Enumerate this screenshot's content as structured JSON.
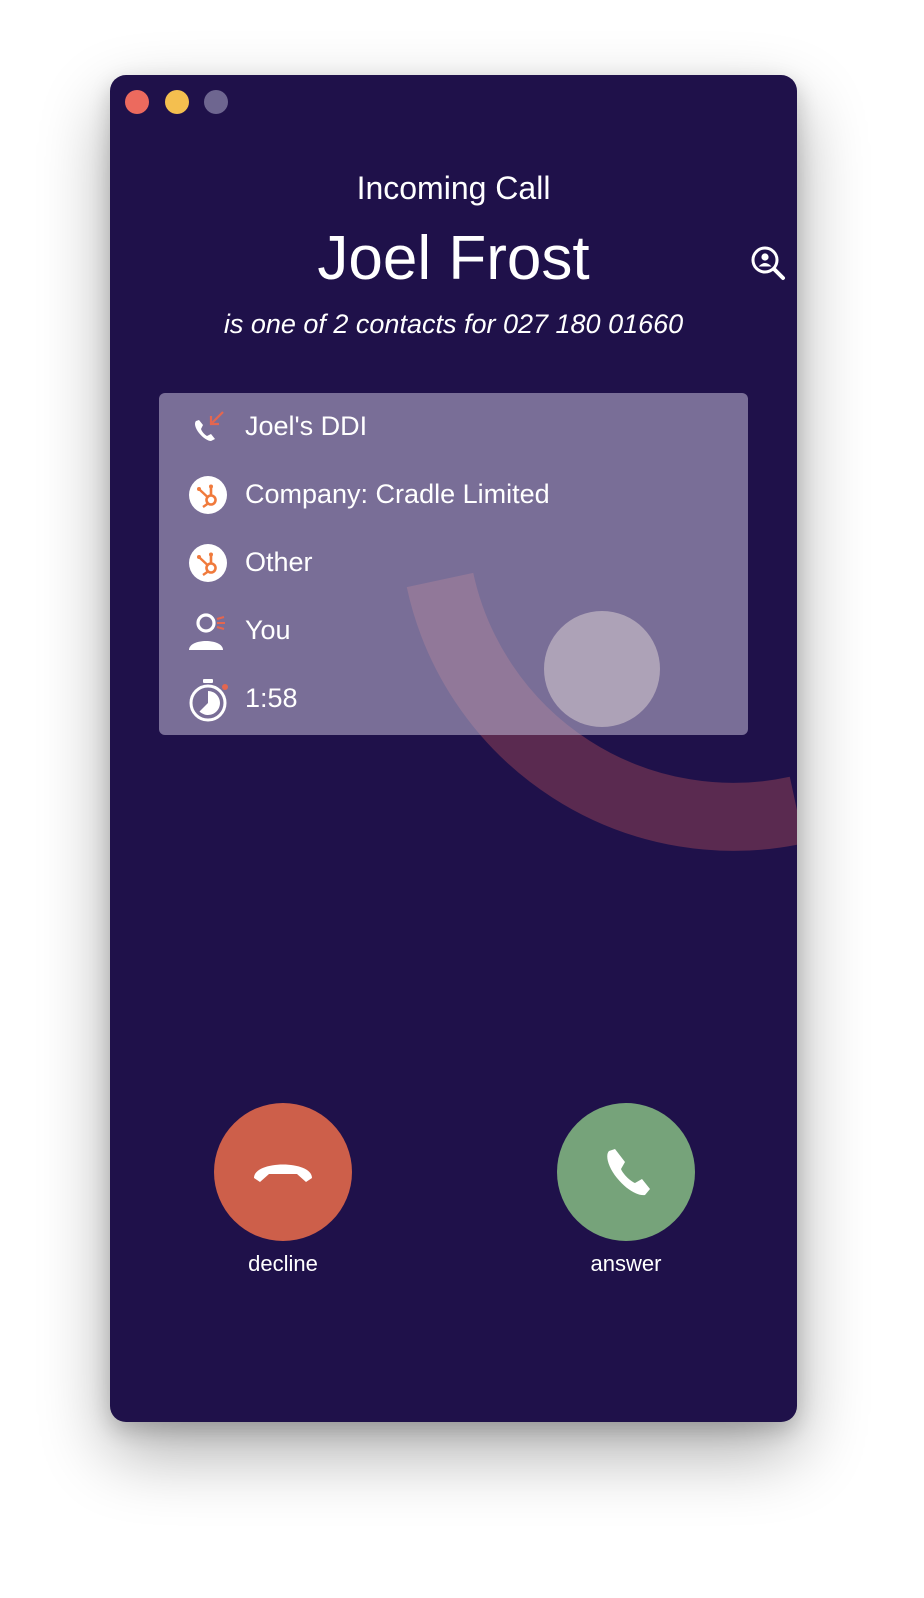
{
  "window": {
    "controls": [
      "close",
      "minimize",
      "zoom"
    ]
  },
  "call": {
    "header": "Incoming Call",
    "contact_name": "Joel Frost",
    "subtitle": "is one of 2 contacts for 027 180 01660"
  },
  "details": [
    {
      "icon": "incoming-call-icon",
      "text": "Joel's DDI"
    },
    {
      "icon": "hubspot-icon",
      "text": "Company: Cradle Limited"
    },
    {
      "icon": "hubspot-icon",
      "text": "Other"
    },
    {
      "icon": "user-owner-icon",
      "text": "You"
    },
    {
      "icon": "stopwatch-icon",
      "text": "1:58"
    }
  ],
  "actions": {
    "decline_label": "decline",
    "answer_label": "answer"
  },
  "colors": {
    "window_bg": "#1f114a",
    "decline": "#cd5f4a",
    "answer": "#76a37a",
    "accent_orange": "#f07a3c",
    "accent_red": "#e4664f"
  }
}
